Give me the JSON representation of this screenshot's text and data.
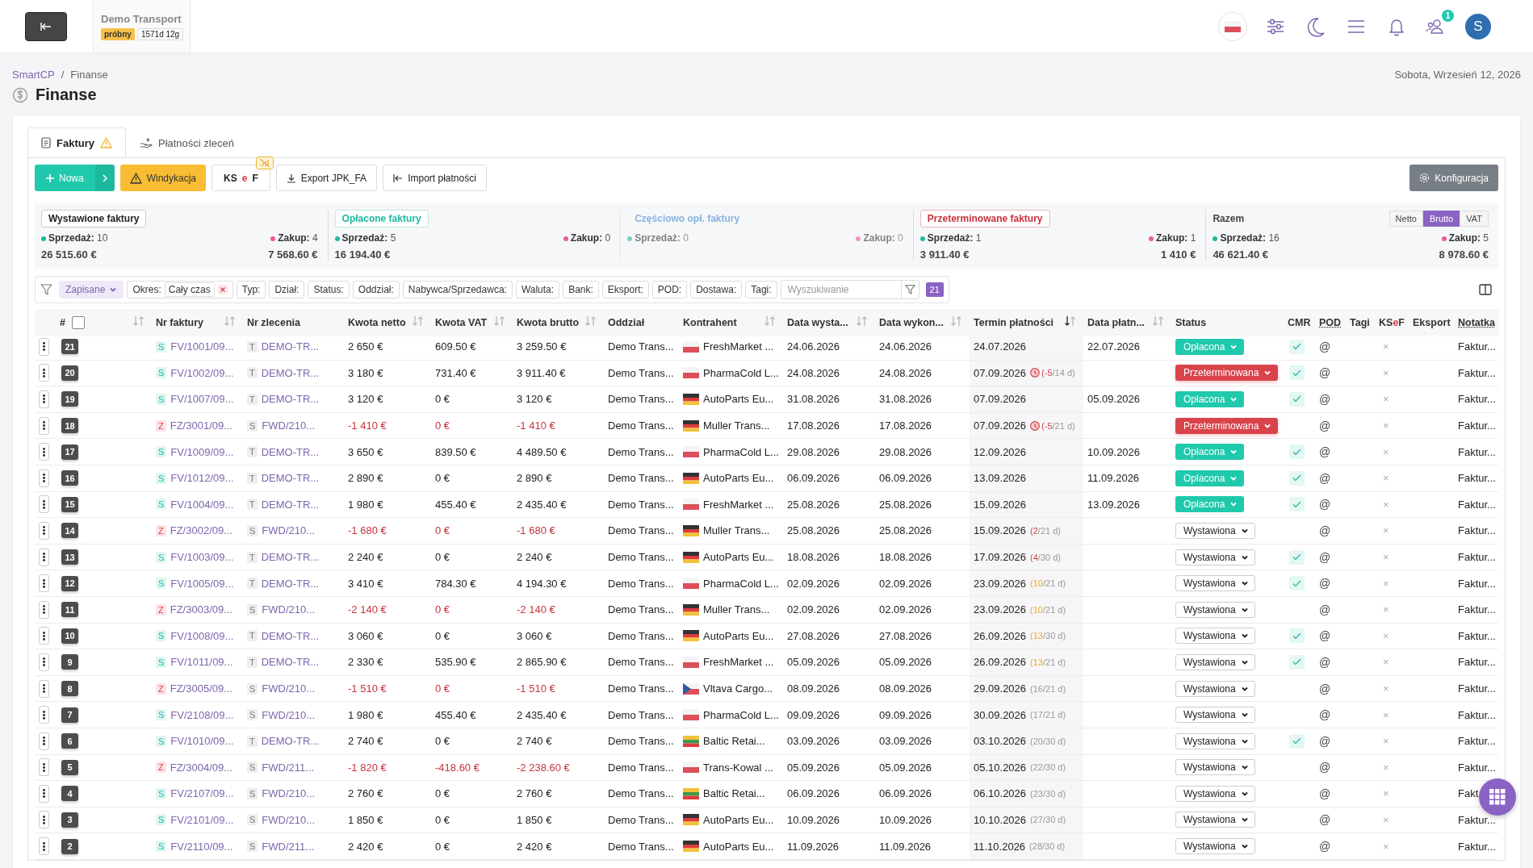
{
  "topbar": {
    "company": "Demo Transport",
    "plan_badge": "próbny",
    "trial_left": "1571d 12g",
    "notifications_badge": "1",
    "avatar_initial": "S"
  },
  "breadcrumb": {
    "items": [
      "SmartCP",
      "Finanse"
    ],
    "separator": "/"
  },
  "date": "Sobota, Wrzesień 12, 2026",
  "page_title": "Finanse",
  "tabs": [
    {
      "label": "Faktury",
      "selected": true,
      "warning": true
    },
    {
      "label": "Płatności zleceń",
      "selected": false,
      "warning": false
    }
  ],
  "toolbar": {
    "new_button": "Nowa",
    "collection_button": "Windykacja",
    "ksef_button": [
      {
        "text": "KS",
        "accent": false
      },
      {
        "text": "e",
        "accent": true
      },
      {
        "text": "F",
        "accent": false
      }
    ],
    "export_button": "Export JPK_FA",
    "import_button": "Import płatności",
    "config_button": "Konfiguracja"
  },
  "summary": [
    {
      "kind": "issued",
      "title": "Wystawione faktury",
      "sales_label": "Sprzedaż:",
      "sales_count": "10",
      "purchase_label": "Zakup:",
      "purchase_count": "4",
      "sales_amount": "26 515.60 €",
      "purchase_amount": "7 568.60 €"
    },
    {
      "kind": "paid",
      "title": "Opłacone faktury",
      "sales_label": "Sprzedaż:",
      "sales_count": "5",
      "purchase_label": "Zakup:",
      "purchase_count": "0",
      "sales_amount": "16 194.40 €"
    },
    {
      "kind": "partial",
      "title": "Częściowo opł. faktury",
      "sales_label": "Sprzedaż:",
      "sales_count": "0",
      "purchase_label": "Zakup:",
      "purchase_count": "0"
    },
    {
      "kind": "overdue",
      "title": "Przeterminowane faktury",
      "sales_label": "Sprzedaż:",
      "sales_count": "1",
      "purchase_label": "Zakup:",
      "purchase_count": "1",
      "sales_amount": "3 911.40 €",
      "purchase_amount": "1 410 €"
    },
    {
      "kind": "total",
      "title": "Razem",
      "sales_label": "Sprzedaż:",
      "sales_count": "16",
      "purchase_label": "Zakup:",
      "purchase_count": "5",
      "sales_amount": "46 621.40 €",
      "purchase_amount": "8 978.60 €",
      "modes": [
        {
          "label": "Netto",
          "selected": false
        },
        {
          "label": "Brutto",
          "selected": true
        },
        {
          "label": "VAT",
          "selected": false
        }
      ]
    }
  ],
  "filters": {
    "saved": "Zapisane",
    "chips": [
      {
        "label": "Okres:",
        "value": "Cały czas"
      },
      {
        "label": "Typ:"
      },
      {
        "label": "Dział:"
      },
      {
        "label": "Status:"
      },
      {
        "label": "Oddział:"
      },
      {
        "label": "Nabywca/Sprzedawca:"
      },
      {
        "label": "Waluta:"
      },
      {
        "label": "Bank:"
      },
      {
        "label": "Eksport:"
      },
      {
        "label": "POD:"
      },
      {
        "label": "Dostawa:"
      },
      {
        "label": "Tagi:"
      }
    ],
    "search_placeholder": "Wyszukiwanie",
    "count": "21"
  },
  "table": {
    "select_all_checked": false,
    "columns": [
      {
        "label": "#",
        "sortable": true,
        "sorted": false,
        "hint": false
      },
      {
        "label": "Nr faktury",
        "sortable": true,
        "sorted": false,
        "hint": false
      },
      {
        "label": "Nr zlecenia",
        "sortable": false,
        "hint": false
      },
      {
        "label": "Kwota netto",
        "sortable": true,
        "sorted": false,
        "hint": false
      },
      {
        "label": "Kwota VAT",
        "sortable": true,
        "sorted": false,
        "hint": false
      },
      {
        "label": "Kwota brutto",
        "sortable": true,
        "sorted": false,
        "hint": false
      },
      {
        "label": "Oddział",
        "sortable": false,
        "hint": false
      },
      {
        "label": "Kontrahent",
        "sortable": true,
        "sorted": false,
        "hint": false
      },
      {
        "label": "Data wysta...",
        "sortable": true,
        "sorted": false,
        "hint": false
      },
      {
        "label": "Data wykon...",
        "sortable": true,
        "sorted": false,
        "hint": false
      },
      {
        "label": "Termin płatności",
        "sortable": true,
        "sorted": true,
        "hint": false
      },
      {
        "label": "Data płatn...",
        "sortable": true,
        "sorted": false,
        "hint": false
      },
      {
        "label": "Status",
        "sortable": false,
        "hint": false
      },
      {
        "label": "CMR",
        "sortable": false,
        "hint": false
      },
      {
        "label": "POD",
        "sortable": false,
        "hint": true
      },
      {
        "label": "Tagi",
        "sortable": false,
        "hint": false
      },
      {
        "parts": [
          {
            "text": "KS",
            "accent": false
          },
          {
            "text": "e",
            "accent": true
          },
          {
            "text": "F",
            "accent": false
          }
        ],
        "sortable": false,
        "hint": false
      },
      {
        "label": "Eksport",
        "sortable": false,
        "hint": false
      },
      {
        "label": "Notatka",
        "sortable": false,
        "hint": true
      }
    ],
    "rows": [
      {
        "no": "21",
        "kind": "sale",
        "doc_type": "S",
        "invoice": "FV/1001/09...",
        "order_type": "T",
        "order": "DEMO-TR...",
        "negative": false,
        "net": "2 650 €",
        "vat": "609.50 €",
        "gross": "3 259.50 €",
        "branch": "Demo Trans...",
        "flag": {
          "kind": "pl"
        },
        "contractor": "FreshMarket ...",
        "issued": "24.06.2026",
        "performed": "24.06.2026",
        "due": "24.07.2026",
        "paid": "22.07.2026",
        "status": {
          "label": "Opłacona",
          "kind": "paid"
        },
        "cmr": true,
        "pod": "@",
        "ksef": "×",
        "note": "Faktur..."
      },
      {
        "no": "20",
        "kind": "sale",
        "doc_type": "S",
        "invoice": "FV/1002/09...",
        "order_type": "T",
        "order": "DEMO-TR...",
        "negative": false,
        "net": "3 180 €",
        "vat": "731.40 €",
        "gross": "3 911.40 €",
        "branch": "Demo Trans...",
        "flag": {
          "kind": "pl"
        },
        "contractor": "PharmaCold L...",
        "issued": "24.08.2026",
        "performed": "24.08.2026",
        "due": "07.09.2026",
        "due_note": {
          "kind": "overdue",
          "left": "(-5",
          "rest": "/14 d)"
        },
        "status": {
          "label": "Przeterminowana",
          "kind": "overdue"
        },
        "cmr": true,
        "pod": "@",
        "ksef": "×",
        "note": "Faktur..."
      },
      {
        "no": "19",
        "kind": "sale",
        "doc_type": "S",
        "invoice": "FV/1007/09...",
        "order_type": "T",
        "order": "DEMO-TR...",
        "negative": false,
        "net": "3 120 €",
        "vat": "0 €",
        "gross": "3 120 €",
        "branch": "Demo Trans...",
        "flag": {
          "kind": "de"
        },
        "contractor": "AutoParts Eu...",
        "issued": "31.08.2026",
        "performed": "31.08.2026",
        "due": "07.09.2026",
        "paid": "05.09.2026",
        "status": {
          "label": "Opłacona",
          "kind": "paid"
        },
        "cmr": true,
        "pod": "@",
        "ksef": "×",
        "note": "Faktur..."
      },
      {
        "no": "18",
        "kind": "purchase",
        "doc_type": "Z",
        "invoice": "FZ/3001/09...",
        "order_type": "S",
        "order": "FWD/210...",
        "negative": true,
        "net": "-1 410 €",
        "vat": "0 €",
        "gross": "-1 410 €",
        "branch": "Demo Trans...",
        "flag": {
          "kind": "de"
        },
        "contractor": "Muller Trans...",
        "issued": "17.08.2026",
        "performed": "17.08.2026",
        "due": "07.09.2026",
        "due_note": {
          "kind": "overdue",
          "left": "(-5",
          "rest": "/21 d)"
        },
        "status": {
          "label": "Przeterminowana",
          "kind": "overdue"
        },
        "cmr": false,
        "pod": "@",
        "ksef": "×",
        "note": "Faktur..."
      },
      {
        "no": "17",
        "kind": "sale",
        "doc_type": "S",
        "invoice": "FV/1009/09...",
        "order_type": "T",
        "order": "DEMO-TR...",
        "negative": false,
        "net": "3 650 €",
        "vat": "839.50 €",
        "gross": "4 489.50 €",
        "branch": "Demo Trans...",
        "flag": {
          "kind": "pl"
        },
        "contractor": "PharmaCold L...",
        "issued": "29.08.2026",
        "performed": "29.08.2026",
        "due": "12.09.2026",
        "paid": "10.09.2026",
        "status": {
          "label": "Opłacona",
          "kind": "paid"
        },
        "cmr": true,
        "pod": "@",
        "ksef": "×",
        "note": "Faktur..."
      },
      {
        "no": "16",
        "kind": "sale",
        "doc_type": "S",
        "invoice": "FV/1012/09...",
        "order_type": "T",
        "order": "DEMO-TR...",
        "negative": false,
        "net": "2 890 €",
        "vat": "0 €",
        "gross": "2 890 €",
        "branch": "Demo Trans...",
        "flag": {
          "kind": "de"
        },
        "contractor": "AutoParts Eu...",
        "issued": "06.09.2026",
        "performed": "06.09.2026",
        "due": "13.09.2026",
        "paid": "11.09.2026",
        "status": {
          "label": "Opłacona",
          "kind": "paid"
        },
        "cmr": true,
        "pod": "@",
        "ksef": "×",
        "note": "Faktur..."
      },
      {
        "no": "15",
        "kind": "sale",
        "doc_type": "S",
        "invoice": "FV/1004/09...",
        "order_type": "T",
        "order": "DEMO-TR...",
        "negative": false,
        "net": "1 980 €",
        "vat": "455.40 €",
        "gross": "2 435.40 €",
        "branch": "Demo Trans...",
        "flag": {
          "kind": "pl"
        },
        "contractor": "FreshMarket ...",
        "issued": "25.08.2026",
        "performed": "25.08.2026",
        "due": "15.09.2026",
        "paid": "13.09.2026",
        "status": {
          "label": "Opłacona",
          "kind": "paid"
        },
        "cmr": true,
        "pod": "@",
        "ksef": "×",
        "note": "Faktur..."
      },
      {
        "no": "14",
        "kind": "purchase",
        "doc_type": "Z",
        "invoice": "FZ/3002/09...",
        "order_type": "S",
        "order": "FWD/210...",
        "negative": true,
        "net": "-1 680 €",
        "vat": "0 €",
        "gross": "-1 680 €",
        "branch": "Demo Trans...",
        "flag": {
          "kind": "de"
        },
        "contractor": "Muller Trans...",
        "issued": "25.08.2026",
        "performed": "25.08.2026",
        "due": "15.09.2026",
        "due_note": {
          "kind": "high",
          "left": "(2",
          "rest": "/21 d)"
        },
        "status": {
          "label": "Wystawiona",
          "kind": "issued"
        },
        "cmr": false,
        "pod": "@",
        "ksef": "×",
        "note": "Faktur..."
      },
      {
        "no": "13",
        "kind": "sale",
        "doc_type": "S",
        "invoice": "FV/1003/09...",
        "order_type": "T",
        "order": "DEMO-TR...",
        "negative": false,
        "net": "2 240 €",
        "vat": "0 €",
        "gross": "2 240 €",
        "branch": "Demo Trans...",
        "flag": {
          "kind": "de"
        },
        "contractor": "AutoParts Eu...",
        "issued": "18.08.2026",
        "performed": "18.08.2026",
        "due": "17.09.2026",
        "due_note": {
          "kind": "high",
          "left": "(4",
          "rest": "/30 d)"
        },
        "status": {
          "label": "Wystawiona",
          "kind": "issued"
        },
        "cmr": true,
        "pod": "@",
        "ksef": "×",
        "note": "Faktur..."
      },
      {
        "no": "12",
        "kind": "sale",
        "doc_type": "S",
        "invoice": "FV/1005/09...",
        "order_type": "T",
        "order": "DEMO-TR...",
        "negative": false,
        "net": "3 410 €",
        "vat": "784.30 €",
        "gross": "4 194.30 €",
        "branch": "Demo Trans...",
        "flag": {
          "kind": "pl"
        },
        "contractor": "PharmaCold L...",
        "issued": "02.09.2026",
        "performed": "02.09.2026",
        "due": "23.09.2026",
        "due_note": {
          "kind": "medium",
          "left": "(10",
          "rest": "/21 d)"
        },
        "status": {
          "label": "Wystawiona",
          "kind": "issued"
        },
        "cmr": true,
        "pod": "@",
        "ksef": "×",
        "note": "Faktur..."
      },
      {
        "no": "11",
        "kind": "purchase",
        "doc_type": "Z",
        "invoice": "FZ/3003/09...",
        "order_type": "S",
        "order": "FWD/210...",
        "negative": true,
        "net": "-2 140 €",
        "vat": "0 €",
        "gross": "-2 140 €",
        "branch": "Demo Trans...",
        "flag": {
          "kind": "de"
        },
        "contractor": "Muller Trans...",
        "issued": "02.09.2026",
        "performed": "02.09.2026",
        "due": "23.09.2026",
        "due_note": {
          "kind": "medium",
          "left": "(10",
          "rest": "/21 d)"
        },
        "status": {
          "label": "Wystawiona",
          "kind": "issued"
        },
        "cmr": false,
        "pod": "@",
        "ksef": "×",
        "note": "Faktur..."
      },
      {
        "no": "10",
        "kind": "sale",
        "doc_type": "S",
        "invoice": "FV/1008/09...",
        "order_type": "T",
        "order": "DEMO-TR...",
        "negative": false,
        "net": "3 060 €",
        "vat": "0 €",
        "gross": "3 060 €",
        "branch": "Demo Trans...",
        "flag": {
          "kind": "de"
        },
        "contractor": "AutoParts Eu...",
        "issued": "27.08.2026",
        "performed": "27.08.2026",
        "due": "26.09.2026",
        "due_note": {
          "kind": "medium",
          "left": "(13",
          "rest": "/30 d)"
        },
        "status": {
          "label": "Wystawiona",
          "kind": "issued"
        },
        "cmr": true,
        "pod": "@",
        "ksef": "×",
        "note": "Faktur..."
      },
      {
        "no": "9",
        "kind": "sale",
        "doc_type": "S",
        "invoice": "FV/1011/09...",
        "order_type": "T",
        "order": "DEMO-TR...",
        "negative": false,
        "net": "2 330 €",
        "vat": "535.90 €",
        "gross": "2 865.90 €",
        "branch": "Demo Trans...",
        "flag": {
          "kind": "pl"
        },
        "contractor": "FreshMarket ...",
        "issued": "05.09.2026",
        "performed": "05.09.2026",
        "due": "26.09.2026",
        "due_note": {
          "kind": "medium",
          "left": "(13",
          "rest": "/21 d)"
        },
        "status": {
          "label": "Wystawiona",
          "kind": "issued"
        },
        "cmr": true,
        "pod": "@",
        "ksef": "×",
        "note": "Faktur..."
      },
      {
        "no": "8",
        "kind": "purchase",
        "doc_type": "Z",
        "invoice": "FZ/3005/09...",
        "order_type": "S",
        "order": "FWD/210...",
        "negative": true,
        "net": "-1 510 €",
        "vat": "0 €",
        "gross": "-1 510 €",
        "branch": "Demo Trans...",
        "flag": {
          "kind": "cz"
        },
        "contractor": "Vltava Cargo...",
        "issued": "08.09.2026",
        "performed": "08.09.2026",
        "due": "29.09.2026",
        "due_note": {
          "kind": "low",
          "left": "(16",
          "rest": "/21 d)"
        },
        "status": {
          "label": "Wystawiona",
          "kind": "issued"
        },
        "cmr": false,
        "pod": "@",
        "ksef": "×",
        "note": "Faktur..."
      },
      {
        "no": "7",
        "kind": "sale",
        "doc_type": "S",
        "invoice": "FV/2108/09...",
        "order_type": "S",
        "order": "FWD/210...",
        "negative": false,
        "net": "1 980 €",
        "vat": "455.40 €",
        "gross": "2 435.40 €",
        "branch": "Demo Trans...",
        "flag": {
          "kind": "pl"
        },
        "contractor": "PharmaCold L...",
        "issued": "09.09.2026",
        "performed": "09.09.2026",
        "due": "30.09.2026",
        "due_note": {
          "kind": "low",
          "left": "(17",
          "rest": "/21 d)"
        },
        "status": {
          "label": "Wystawiona",
          "kind": "issued"
        },
        "cmr": false,
        "pod": "@",
        "ksef": "×",
        "note": "Faktur..."
      },
      {
        "no": "6",
        "kind": "sale",
        "doc_type": "S",
        "invoice": "FV/1010/09...",
        "order_type": "T",
        "order": "DEMO-TR...",
        "negative": false,
        "net": "2 740 €",
        "vat": "0 €",
        "gross": "2 740 €",
        "branch": "Demo Trans...",
        "flag": {
          "kind": "lt"
        },
        "contractor": "Baltic Retai...",
        "issued": "03.09.2026",
        "performed": "03.09.2026",
        "due": "03.10.2026",
        "due_note": {
          "kind": "low",
          "left": "(20",
          "rest": "/30 d)"
        },
        "status": {
          "label": "Wystawiona",
          "kind": "issued"
        },
        "cmr": true,
        "pod": "@",
        "ksef": "×",
        "note": "Faktur..."
      },
      {
        "no": "5",
        "kind": "purchase",
        "doc_type": "Z",
        "invoice": "FZ/3004/09...",
        "order_type": "S",
        "order": "FWD/211...",
        "negative": true,
        "net": "-1 820 €",
        "vat": "-418.60 €",
        "gross": "-2 238.60 €",
        "branch": "Demo Trans...",
        "flag": {
          "kind": "pl"
        },
        "contractor": "Trans-Kowal ...",
        "issued": "05.09.2026",
        "performed": "05.09.2026",
        "due": "05.10.2026",
        "due_note": {
          "kind": "low",
          "left": "(22",
          "rest": "/30 d)"
        },
        "status": {
          "label": "Wystawiona",
          "kind": "issued"
        },
        "cmr": false,
        "pod": "@",
        "ksef": "×",
        "note": "Faktur..."
      },
      {
        "no": "4",
        "kind": "sale",
        "doc_type": "S",
        "invoice": "FV/2107/09...",
        "order_type": "S",
        "order": "FWD/210...",
        "negative": false,
        "net": "2 760 €",
        "vat": "0 €",
        "gross": "2 760 €",
        "branch": "Demo Trans...",
        "flag": {
          "kind": "lt"
        },
        "contractor": "Baltic Retai...",
        "issued": "06.09.2026",
        "performed": "06.09.2026",
        "due": "06.10.2026",
        "due_note": {
          "kind": "low",
          "left": "(23",
          "rest": "/30 d)"
        },
        "status": {
          "label": "Wystawiona",
          "kind": "issued"
        },
        "cmr": false,
        "pod": "@",
        "ksef": "×",
        "note": "Fakt"
      },
      {
        "no": "3",
        "kind": "sale",
        "doc_type": "S",
        "invoice": "FV/2101/09...",
        "order_type": "S",
        "order": "FWD/210...",
        "negative": false,
        "net": "1 850 €",
        "vat": "0 €",
        "gross": "1 850 €",
        "branch": "Demo Trans...",
        "flag": {
          "kind": "de"
        },
        "contractor": "AutoParts Eu...",
        "issued": "10.09.2026",
        "performed": "10.09.2026",
        "due": "10.10.2026",
        "due_note": {
          "kind": "low",
          "left": "(27",
          "rest": "/30 d)"
        },
        "status": {
          "label": "Wystawiona",
          "kind": "issued"
        },
        "cmr": false,
        "pod": "@",
        "ksef": "×",
        "note": "Faktur..."
      },
      {
        "no": "2",
        "kind": "sale",
        "doc_type": "S",
        "invoice": "FV/2110/09...",
        "order_type": "S",
        "order": "FWD/211...",
        "negative": false,
        "net": "2 420 €",
        "vat": "0 €",
        "gross": "2 420 €",
        "branch": "Demo Trans...",
        "flag": {
          "kind": "de"
        },
        "contractor": "AutoParts Eu...",
        "issued": "11.09.2026",
        "performed": "11.09.2026",
        "due": "11.10.2026",
        "due_note": {
          "kind": "low",
          "left": "(28",
          "rest": "/30 d)"
        },
        "status": {
          "label": "Wystawiona",
          "kind": "issued"
        },
        "cmr": false,
        "pod": "@",
        "ksef": "×",
        "note": "Faktur..."
      }
    ]
  }
}
